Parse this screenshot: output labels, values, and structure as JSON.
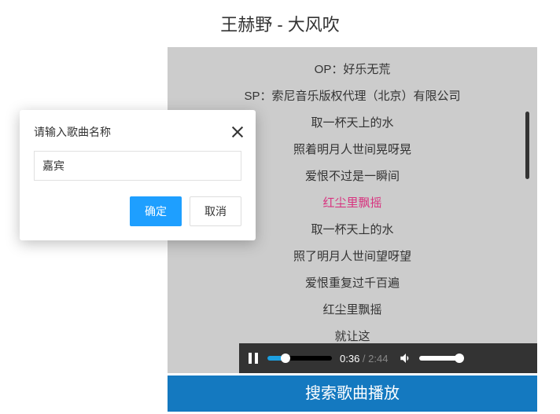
{
  "page": {
    "title": "王赫野 - 大风吹"
  },
  "lyrics": {
    "lines": [
      "OP：好乐无荒",
      "SP：索尼音乐版权代理（北京）有限公司",
      "取一杯天上的水",
      "照着明月人世间晃呀晃",
      "爱恨不过是一瞬间",
      "红尘里飘摇",
      "取一杯天上的水",
      "照了明月人世间望呀望",
      "爱恨重复过千百遍",
      "红尘里飘摇",
      "就让这"
    ],
    "active_index": 5
  },
  "player": {
    "current_time": "0:36",
    "duration": "2:44",
    "progress_pct": 24
  },
  "search_button": "搜索歌曲播放",
  "modal": {
    "title": "请输入歌曲名称",
    "input_value": "嘉宾",
    "confirm": "确定",
    "cancel": "取消"
  }
}
